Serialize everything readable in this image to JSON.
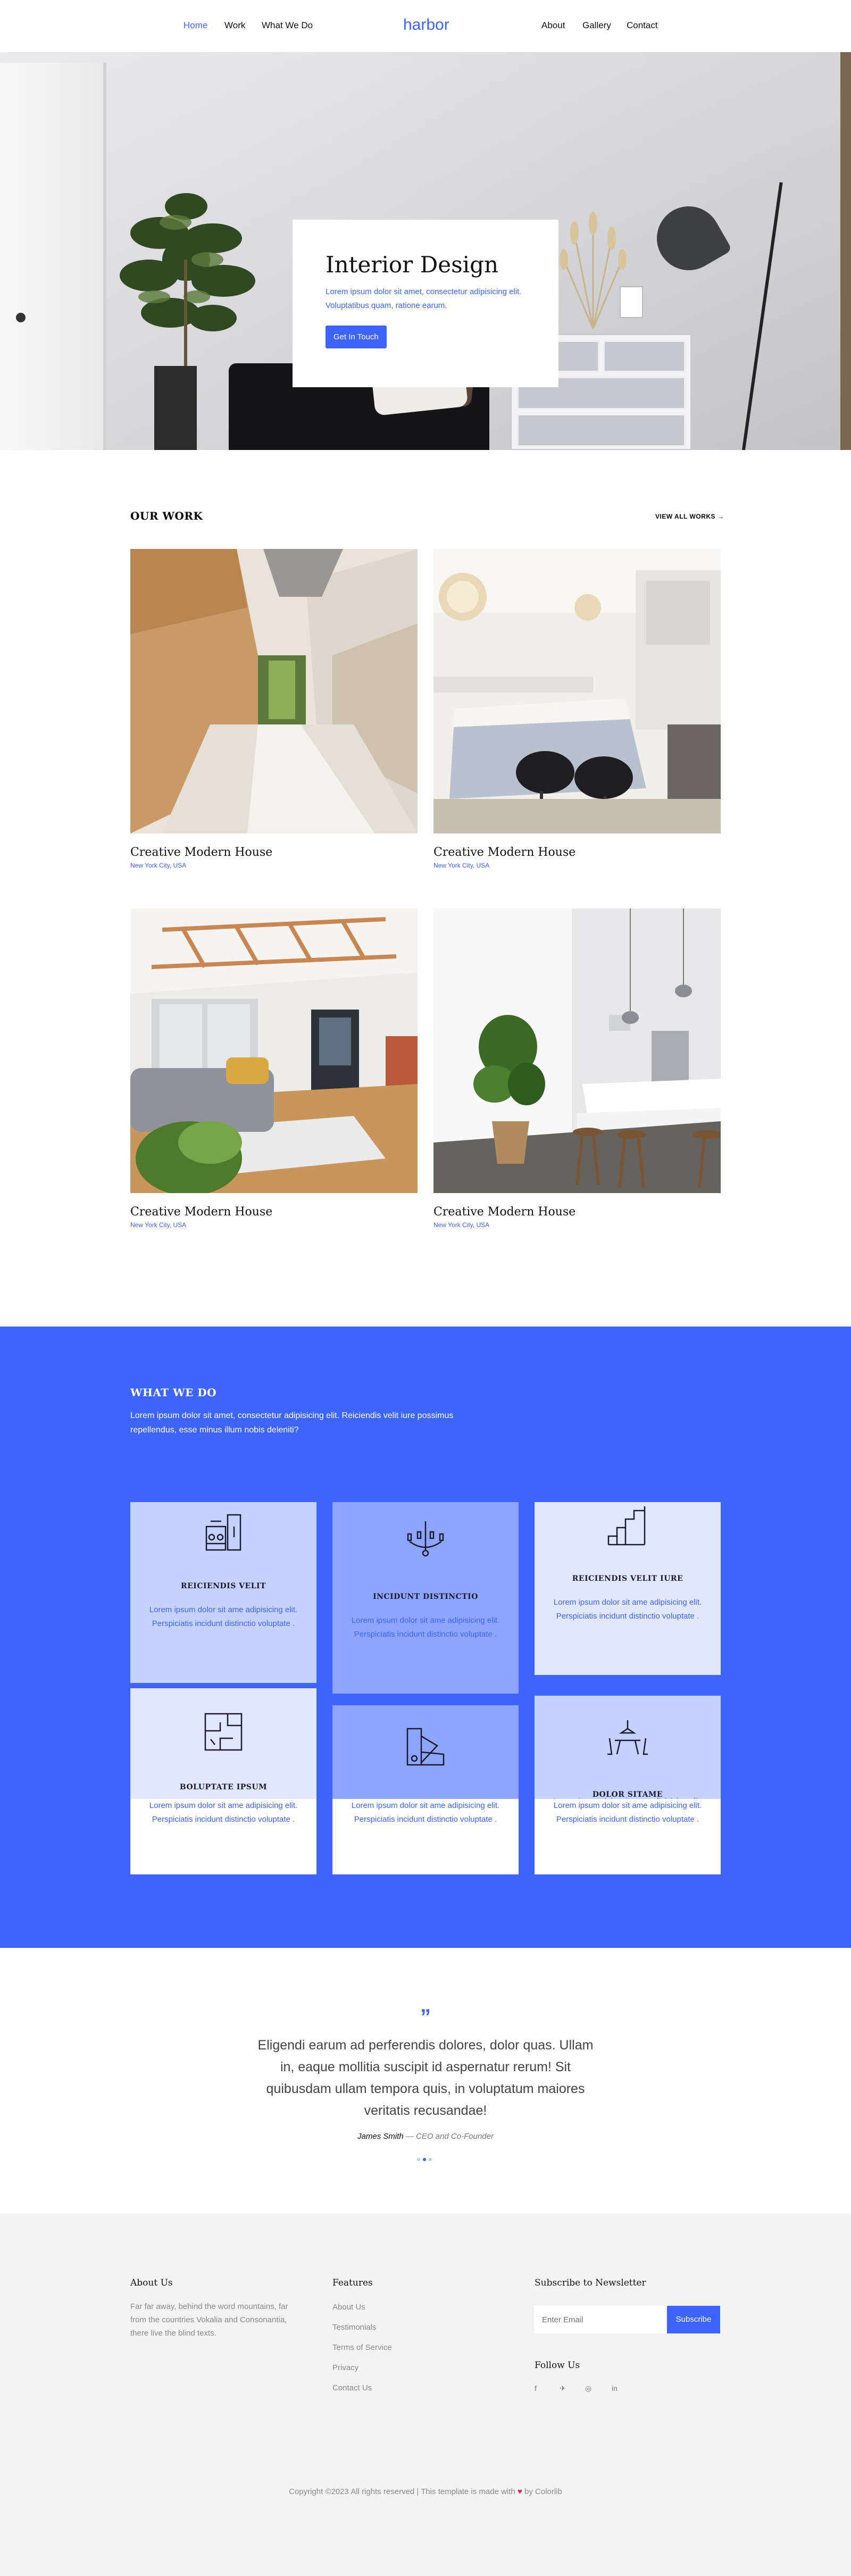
{
  "nav": {
    "home": "Home",
    "work": "Work",
    "what_we_do": "What We Do",
    "brand": "harbor",
    "about": "About",
    "gallery": "Gallery",
    "contact": "Contact"
  },
  "hero": {
    "title": "Interior Design",
    "text": "Lorem ipsum dolor sit amet, consectetur adipisicing elit. Voluptatibus quam, ratione earum.",
    "button": "Get In Touch",
    "slide_count": 3,
    "active_slide": 3
  },
  "work": {
    "heading": "OUR WORK",
    "view_all": "VIEW ALL WORKS",
    "arrow_icon": "arrow-right-icon",
    "items": [
      {
        "title": "Creative Modern House",
        "location": "New York City, USA"
      },
      {
        "title": "Creative Modern House",
        "location": "New York City, USA"
      },
      {
        "title": "Creative Modern House",
        "location": "New York City, USA"
      },
      {
        "title": "Creative Modern House",
        "location": "New York City, USA"
      }
    ]
  },
  "services": {
    "heading": "WHAT WE DO",
    "intro": "Lorem ipsum dolor sit amet, consectetur adipisicing elit. Reiciendis velit iure possimus repellendus, esse minus illum nobis deleniti?",
    "items": [
      {
        "title": "REICIENDIS VELIT",
        "text": "Lorem ipsum dolor sit ame adipisicing elit. Perspiciatis incidunt distinctio voluptate .",
        "icon": "kitchen-icon"
      },
      {
        "title": "INCIDUNT DISTINCTIO",
        "text": "Lorem ipsum dolor sit ame adipisicing elit. Perspiciatis incidunt distinctio voluptate .",
        "icon": "chandelier-icon"
      },
      {
        "title": "REICIENDIS VELIT IURE",
        "text": "Lorem ipsum dolor sit ame adipisicing elit. Perspiciatis incidunt distinctio voluptate .",
        "icon": "stairs-icon"
      },
      {
        "title": "BOLUPTATE IPSUM",
        "text": "Lorem ipsum dolor sit ame adipisicing elit. Perspiciatis incidunt distinctio voluptate .",
        "icon": "floor-plan-icon"
      },
      {
        "title": "",
        "text": "Lorem ipsum dolor sit ame adipisicing elit. Perspiciatis incidunt distinctio voluptate .",
        "icon": "color-swatch-icon"
      },
      {
        "title": "DOLOR SITAME",
        "text": "Lorem ipsum dolor sit ame adipisicing elit. Perspiciatis incidunt distinctio voluptate .",
        "icon": "dining-table-icon"
      }
    ]
  },
  "testimonial": {
    "quote": "Eligendi earum ad perferendis dolores, dolor quas. Ullam in, eaque mollitia suscipit id aspernatur rerum! Sit quibusdam ullam tempora quis, in voluptatum maiores veritatis recusandae!",
    "author": "James Smith",
    "role": "— CEO and Co-Founder"
  },
  "footer": {
    "about_heading": "About Us",
    "about_text": "Far far away, behind the word mountains, far from the countries Vokalia and Consonantia, there live the blind texts.",
    "features_heading": "Features",
    "features": [
      "About Us",
      "Testimonials",
      "Terms of Service",
      "Privacy",
      "Contact Us"
    ],
    "newsletter_heading": "Subscribe to Newsletter",
    "email_placeholder": "Enter Email",
    "subscribe_button": "Subscribe",
    "follow_heading": "Follow Us",
    "social": [
      {
        "icon": "facebook-icon",
        "glyph": "f"
      },
      {
        "icon": "twitter-icon",
        "glyph": "✈"
      },
      {
        "icon": "instagram-icon",
        "glyph": "◎"
      },
      {
        "icon": "linkedin-icon",
        "glyph": "in"
      }
    ],
    "copyright_pre": "Copyright ©2023 All rights reserved | This template is made with",
    "copyright_post": "by Colorlib"
  },
  "colors": {
    "accent": "#3e64ff",
    "footer_bg": "#f3f3f3"
  }
}
